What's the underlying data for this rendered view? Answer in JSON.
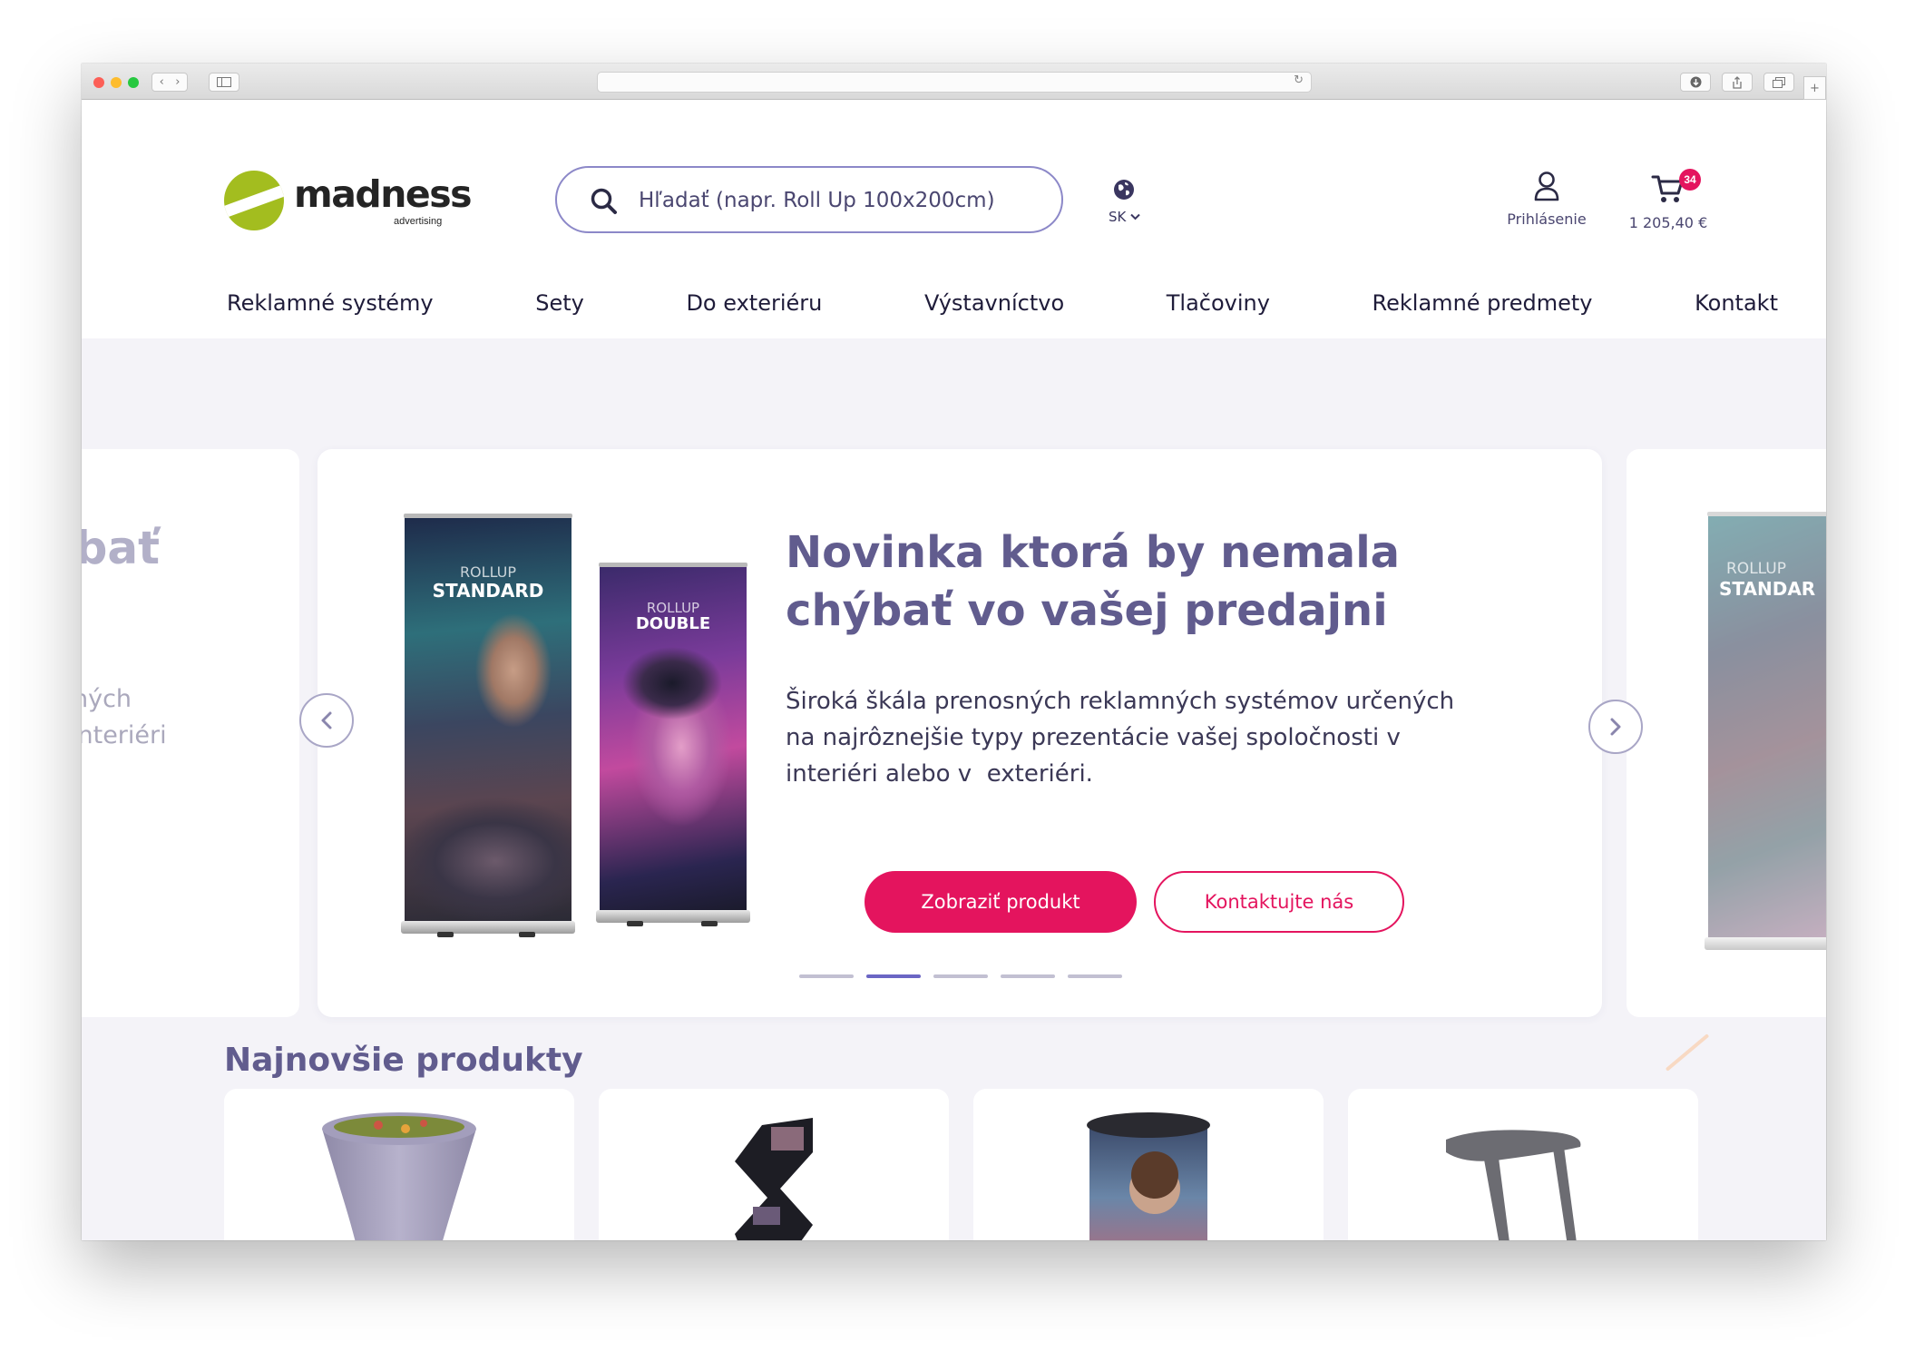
{
  "logo": {
    "name": "madness",
    "tagline": "advertising",
    "brand_color": "#a3bd1f"
  },
  "search": {
    "placeholder": "Hľadať (napr. Roll Up 100x200cm)",
    "icon": "search-icon"
  },
  "language": {
    "code": "SK",
    "icon": "globe-icon"
  },
  "account": {
    "label": "Prihlásenie",
    "icon": "user-icon"
  },
  "cart": {
    "badge": "34",
    "total": "1 205,40 €",
    "icon": "cart-icon"
  },
  "nav": [
    "Reklamné systémy",
    "Sety",
    "Do exteriéru",
    "Výstavníctvo",
    "Tlačoviny",
    "Reklamné predmety",
    "Kontakt"
  ],
  "hero": {
    "title_lines": [
      "Novinka ktorá by nemala",
      "chýbať vo vašej predajni"
    ],
    "description_lines": [
      "Široká škála prenosných reklamných systémov určených",
      "na najrôznejšie typy prezentácie vašej spoločnosti v",
      "interiéri alebo v  exteriéri."
    ],
    "primary_button": "Zobraziť produkt",
    "secondary_button": "Kontaktujte nás",
    "rollup_standard": {
      "line1": "ROLLUP",
      "line2": "STANDARD"
    },
    "rollup_double": {
      "line1": "ROLLUP",
      "line2": "DOUBLE"
    }
  },
  "prev_slide": {
    "title_fragment": "ýbať",
    "line1_fragment": "ných",
    "line2_fragment": "interiéri"
  },
  "next_slide": {
    "line1": "ROLLUP",
    "line2": "STANDAR"
  },
  "carousel": {
    "slide_count": 5,
    "active_index": 1
  },
  "newest": {
    "title": "Najnovšie produkty",
    "products": [
      {
        "image": "round table cover"
      },
      {
        "image": "folding brochure stand"
      },
      {
        "image": "promo counter"
      },
      {
        "image": "bar stool"
      }
    ]
  },
  "colors": {
    "accent": "#e4145e",
    "heading": "#615c8e",
    "active_dot": "#6b66c4",
    "search_border": "#8c88c8"
  }
}
